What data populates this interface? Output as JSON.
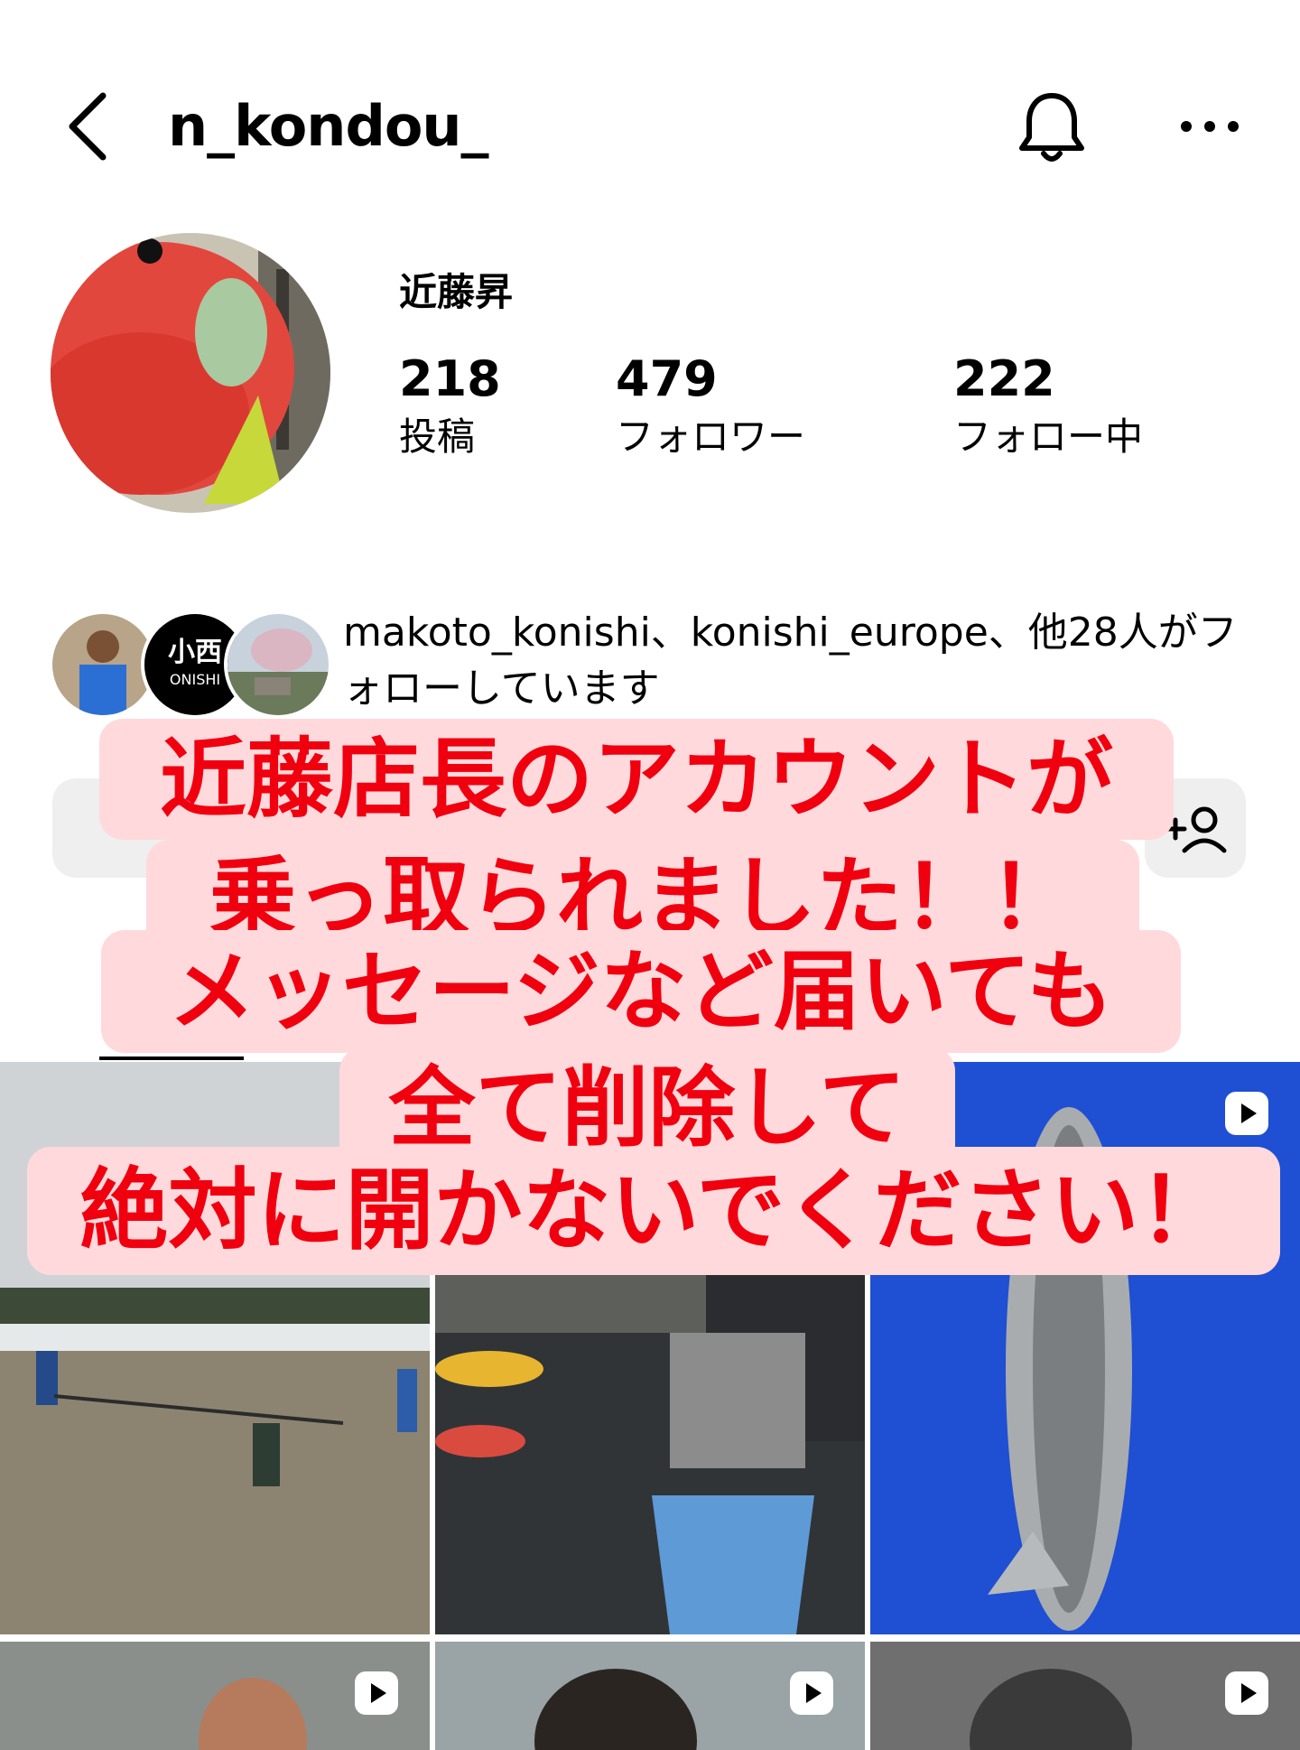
{
  "header": {
    "username": "n_kondou_"
  },
  "profile": {
    "name": "近藤昇",
    "stats": [
      {
        "value": "218",
        "label": "投稿"
      },
      {
        "value": "479",
        "label": "フォロワー"
      },
      {
        "value": "222",
        "label": "フォロー中"
      }
    ]
  },
  "mutual": {
    "text": "makoto_konishi、konishi_europe、他28人がフォローしています",
    "badge_text": "小西",
    "badge_sub": "ONISHI"
  },
  "warning": {
    "lines": [
      "近藤店長のアカウントが",
      "乗っ取られました！！",
      "メッセージなど届いても",
      "全て削除して",
      "絶対に開かないでください！"
    ]
  },
  "colors": {
    "warning_text": "#f0000f",
    "warning_bg": "#ffd9dc",
    "button_bg": "#efefef"
  },
  "icons": {
    "back": "chevron-left-icon",
    "bell": "bell-icon",
    "more": "more-horizontal-icon",
    "add_user": "add-user-icon",
    "reel": "reel-play-icon"
  },
  "grid": {
    "posts": [
      {
        "subject": "pond-netting",
        "reel": false
      },
      {
        "subject": "feeding-koi",
        "reel": false
      },
      {
        "subject": "koi-fish",
        "reel": true
      },
      {
        "subject": "person-1",
        "reel": true
      },
      {
        "subject": "person-2",
        "reel": true
      },
      {
        "subject": "person-3",
        "reel": true
      }
    ]
  }
}
